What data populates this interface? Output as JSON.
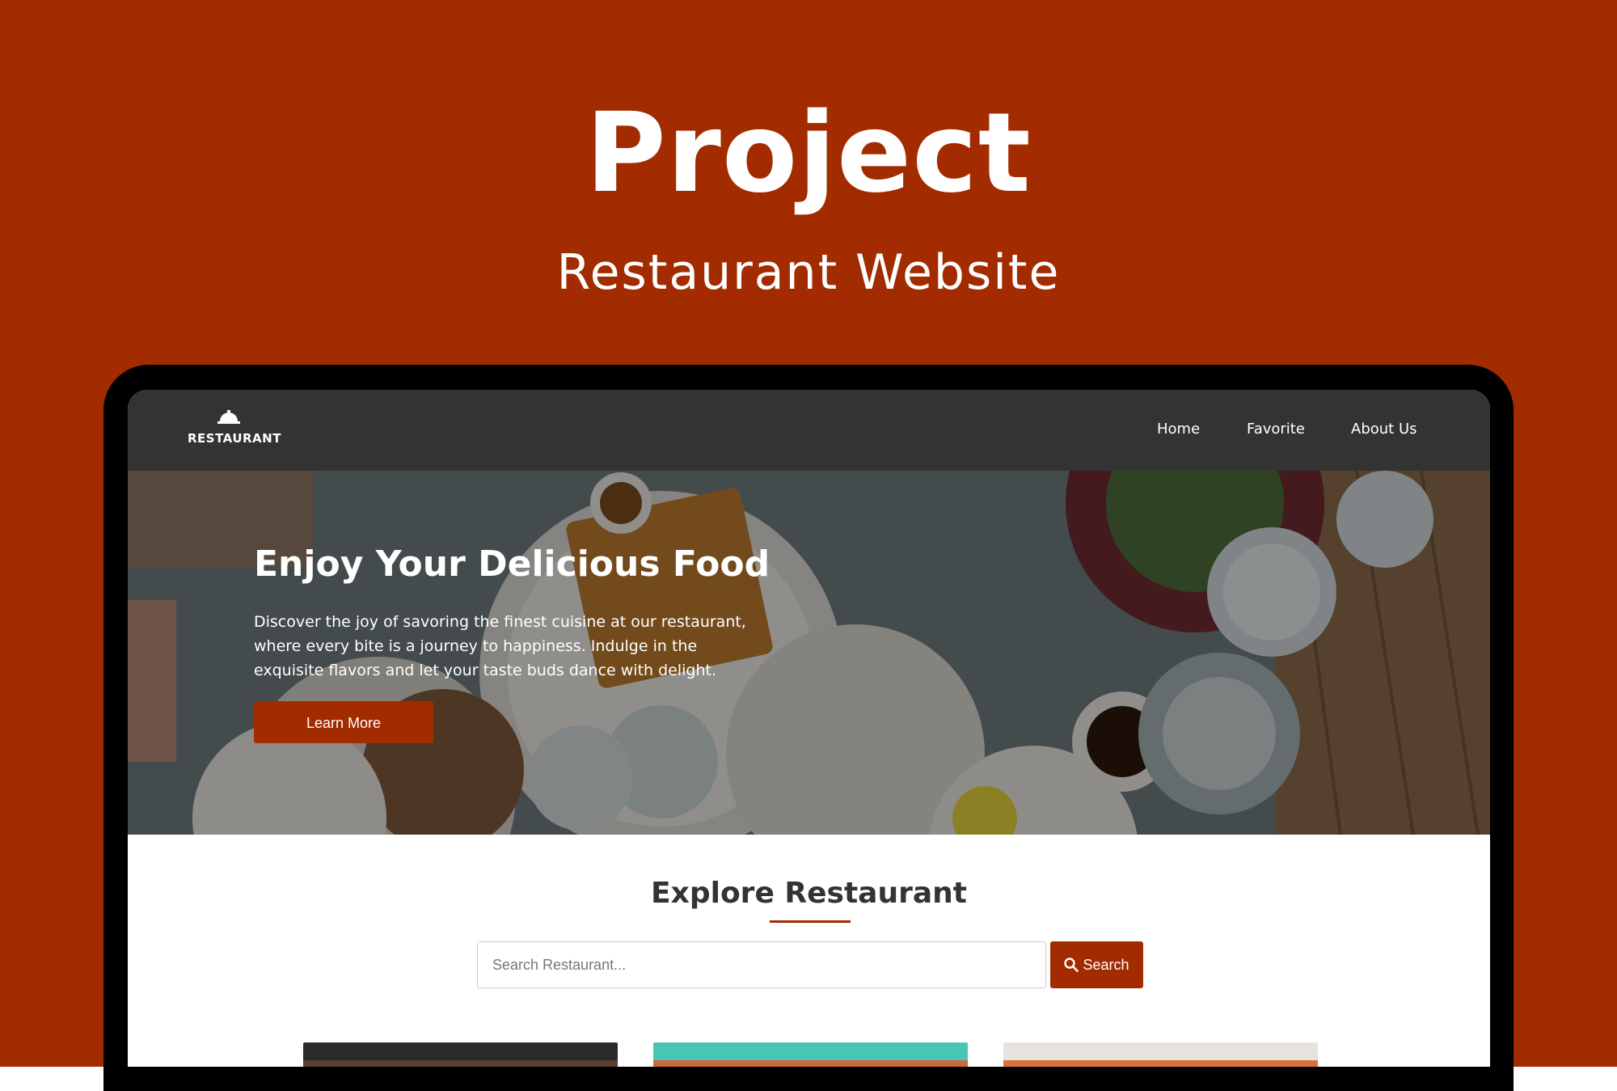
{
  "page": {
    "title": "Project",
    "subtitle": "Restaurant Website"
  },
  "site": {
    "logo_text": "RESTAURANT",
    "nav": [
      {
        "label": "Home"
      },
      {
        "label": "Favorite"
      },
      {
        "label": "About Us"
      }
    ],
    "hero": {
      "heading": "Enjoy Your Delicious Food",
      "description": "Discover the joy of savoring the finest cuisine at our restaurant, where every bite is a journey to happiness. Indulge in the exquisite flavors and let your taste buds dance with delight.",
      "button_label": "Learn More"
    },
    "explore": {
      "title": "Explore Restaurant",
      "search_placeholder": "Search Restaurant...",
      "search_value": "",
      "search_button": "Search"
    },
    "icons": {
      "logo": "cloche-icon",
      "search": "search-icon"
    }
  },
  "colors": {
    "brand": "#A32B00",
    "navbar": "#333333",
    "device_frame": "#000000",
    "heading_text": "#333333"
  }
}
